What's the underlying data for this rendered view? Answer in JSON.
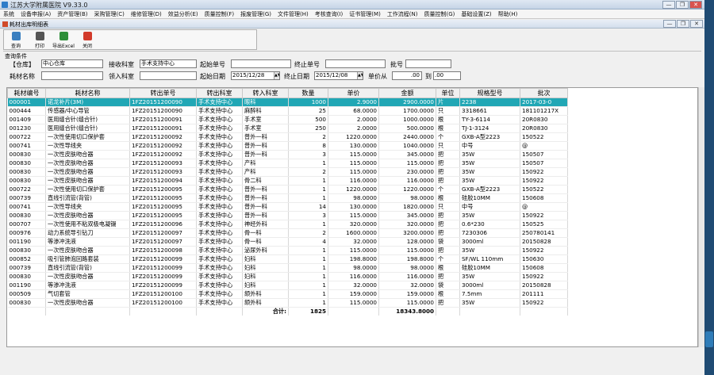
{
  "window": {
    "title": "江苏大学附属医院 V9.33.0",
    "min": "—",
    "max": "❐",
    "close": "✕"
  },
  "menu": [
    "系统",
    "设备申报(A)",
    "资产管理(B)",
    "采购管理(C)",
    "维修管理(D)",
    "效益分析(E)",
    "质量控制(F)",
    "报废管理(G)",
    "文件管理(H)",
    "考核查询(I)",
    "证书管理(M)",
    "工作流程(N)",
    "质量控制(G)",
    "基础设置(Z)",
    "帮助(H)"
  ],
  "child_window": {
    "title": "耗材出库明细表",
    "min": "—",
    "max": "❐",
    "close": "✕"
  },
  "toolbar": [
    {
      "label": "查询",
      "icon": "search-icon",
      "color": "#3a7fc0"
    },
    {
      "label": "打印",
      "icon": "print-icon",
      "color": "#555555"
    },
    {
      "label": "导出Excel",
      "icon": "excel-icon",
      "color": "#2f8f3a"
    },
    {
      "label": "关闭",
      "icon": "close-icon",
      "color": "#d23a2a"
    }
  ],
  "query": {
    "section_label": "查询条件",
    "dept_label": "【仓库】",
    "dept_value": "中心仓库",
    "receive_label": "接收科室",
    "receive_value": "手术支持中心",
    "start_no_label": "起始单号",
    "start_no_value": "",
    "end_no_label": "终止单号",
    "end_no_value": "",
    "batch_label": "批号",
    "batch_value": "",
    "name_label": "耗材名称",
    "name_value": "",
    "dept2_label": "领入科室",
    "dept2_value": "",
    "start_date_label": "起始日期",
    "start_date_value": "2015/12/28",
    "end_date_label": "终止日期",
    "end_date_value": "2015/12/08",
    "price_from_label": "单价从",
    "price_from_value": ".00",
    "price_to_label": "到",
    "price_to_value": ".00"
  },
  "table": {
    "columns": [
      "耗材编号",
      "耗材名称",
      "转出单号",
      "转出科室",
      "转入科室",
      "数量",
      "单价",
      "金额",
      "单位",
      "规格型号",
      "批次"
    ],
    "rows": [
      [
        "000001",
        "诺龙补片(3M)",
        "1FZ20151200090",
        "手术支持中心",
        "眼科",
        "1000",
        "2.9000",
        "2900.0000",
        "片",
        "2238",
        "2017-03-0"
      ],
      [
        "000444",
        "传感器/中心导管",
        "1FZ20151200090",
        "手术支持中心",
        "麻醉科",
        "25",
        "68.0000",
        "1700.0000",
        "只",
        "3318661",
        "181101217X"
      ],
      [
        "001409",
        "医用缝合针(缝合针)",
        "1FZ20151200091",
        "手术支持中心",
        "手术室",
        "500",
        "2.0000",
        "1000.0000",
        "根",
        "TY-3-6114",
        "20R0830"
      ],
      [
        "001230",
        "医用缝合针(缝合针)",
        "1FZ20151200091",
        "手术支持中心",
        "手术室",
        "250",
        "2.0000",
        "500.0000",
        "根",
        "TJ-1-3124",
        "20R0830"
      ],
      [
        "000722",
        "一次性使用切口保护套",
        "1FZ20151200092",
        "手术支持中心",
        "普外一科",
        "2",
        "1220.0000",
        "2440.0000",
        "个",
        "GXB-A型2223",
        "150522"
      ],
      [
        "000741",
        "一次性导线夹",
        "1FZ20151200092",
        "手术支持中心",
        "普外一科",
        "8",
        "130.0000",
        "1040.0000",
        "只",
        "中号",
        "@"
      ],
      [
        "000830",
        "一次性皮肤吻合器",
        "1FZ20151200092",
        "手术支持中心",
        "普外一科",
        "3",
        "115.0000",
        "345.0000",
        "把",
        "35W",
        "150507"
      ],
      [
        "000830",
        "一次性皮肤吻合器",
        "1FZ20151200093",
        "手术支持中心",
        "产科",
        "1",
        "115.0000",
        "115.0000",
        "把",
        "35W",
        "150507"
      ],
      [
        "000830",
        "一次性皮肤吻合器",
        "1FZ20151200093",
        "手术支持中心",
        "产科",
        "2",
        "115.0000",
        "230.0000",
        "把",
        "35W",
        "150922"
      ],
      [
        "000830",
        "一次性皮肤吻合器",
        "1FZ20151200094",
        "手术支持中心",
        "骨二科",
        "1",
        "116.0000",
        "116.0000",
        "把",
        "35W",
        "150922"
      ],
      [
        "000722",
        "一次性使用切口保护套",
        "1FZ20151200095",
        "手术支持中心",
        "普外一科",
        "1",
        "1220.0000",
        "1220.0000",
        "个",
        "GXB-A型2223",
        "150522"
      ],
      [
        "000739",
        "直线引流管(背管)",
        "1FZ20151200095",
        "手术支持中心",
        "普外一科",
        "1",
        "98.0000",
        "98.0000",
        "根",
        "硅胶10MM",
        "150608"
      ],
      [
        "000741",
        "一次性导线夹",
        "1FZ20151200095",
        "手术支持中心",
        "普外一科",
        "14",
        "130.0000",
        "1820.0000",
        "只",
        "中号",
        "@"
      ],
      [
        "000830",
        "一次性皮肤吻合器",
        "1FZ20151200095",
        "手术支持中心",
        "普外一科",
        "3",
        "115.0000",
        "345.0000",
        "把",
        "35W",
        "150922"
      ],
      [
        "000707",
        "一次性使用不粘双极电凝镊",
        "1FZ20151200096",
        "手术支持中心",
        "神经外科",
        "1",
        "320.0000",
        "320.0000",
        "把",
        "0.6*230",
        "150525"
      ],
      [
        "000976",
        "动力系统导引钻刀",
        "1FZ20151200097",
        "手术支持中心",
        "骨一科",
        "2",
        "1600.0000",
        "3200.0000",
        "把",
        "7230306",
        "250780141"
      ],
      [
        "001190",
        "等渗冲洗液",
        "1FZ20151200097",
        "手术支持中心",
        "骨一科",
        "4",
        "32.0000",
        "128.0000",
        "袋",
        "3000ml",
        "20150828"
      ],
      [
        "000830",
        "一次性皮肤吻合器",
        "1FZ20151200098",
        "手术支持中心",
        "泌尿外科",
        "1",
        "115.0000",
        "115.0000",
        "把",
        "35W",
        "150922"
      ],
      [
        "000852",
        "吸引管肺泡回路套装",
        "1FZ20151200099",
        "手术支持中心",
        "妇科",
        "1",
        "198.8000",
        "198.8000",
        "个",
        "SF/WL 110mm",
        "150630"
      ],
      [
        "000739",
        "直线引流管(背管)",
        "1FZ20151200099",
        "手术支持中心",
        "妇科",
        "1",
        "98.0000",
        "98.0000",
        "根",
        "硅胶10MM",
        "150608"
      ],
      [
        "000830",
        "一次性皮肤吻合器",
        "1FZ20151200099",
        "手术支持中心",
        "妇科",
        "1",
        "116.0000",
        "116.0000",
        "把",
        "35W",
        "150922"
      ],
      [
        "001190",
        "等渗冲洗液",
        "1FZ20151200099",
        "手术支持中心",
        "妇科",
        "1",
        "32.0000",
        "32.0000",
        "袋",
        "3000ml",
        "20150828"
      ],
      [
        "000509",
        "气切套管",
        "1FZ20151200100",
        "手术支持中心",
        "颌外科",
        "1",
        "159.0000",
        "159.0000",
        "根",
        "7.5mm",
        "201111"
      ],
      [
        "000830",
        "一次性皮肤吻合器",
        "1FZ20151200100",
        "手术支持中心",
        "颌外科",
        "1",
        "115.0000",
        "115.0000",
        "把",
        "35W",
        "150922"
      ]
    ],
    "total_label": "合计:",
    "total_qty": "1825",
    "total_amount": "18343.8000"
  }
}
